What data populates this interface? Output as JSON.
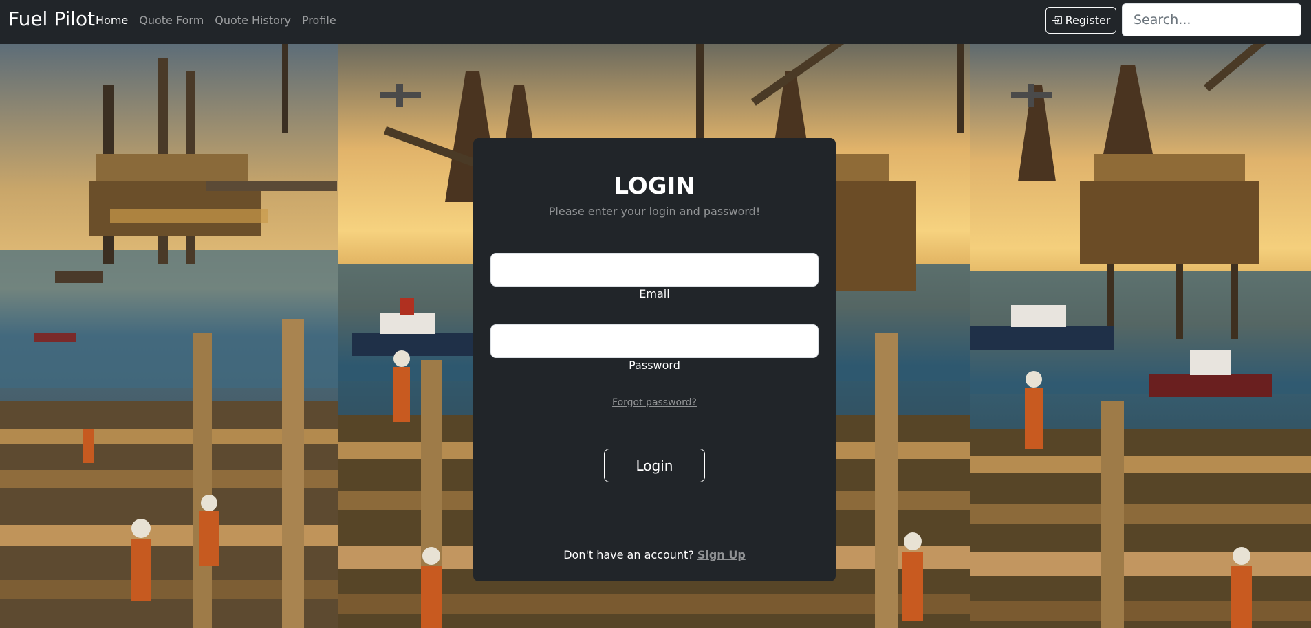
{
  "navbar": {
    "brand": "Fuel Pilot",
    "links": [
      {
        "label": "Home",
        "active": true
      },
      {
        "label": "Quote Form",
        "active": false
      },
      {
        "label": "Quote History",
        "active": false
      },
      {
        "label": "Profile",
        "active": false
      }
    ],
    "register_label": "Register",
    "register_icon": "sign-in-icon",
    "search_placeholder": "Search..."
  },
  "login": {
    "title": "LOGIN",
    "subtitle": "Please enter your login and password!",
    "email_label": "Email",
    "email_value": "",
    "password_label": "Password",
    "password_value": "",
    "forgot_label": "Forgot password?",
    "login_button": "Login",
    "signup_prompt": "Don't have an account?",
    "signup_label": "Sign Up"
  },
  "colors": {
    "navbar_bg": "#212529",
    "card_bg": "#212529",
    "input_bg": "#ffffff"
  }
}
